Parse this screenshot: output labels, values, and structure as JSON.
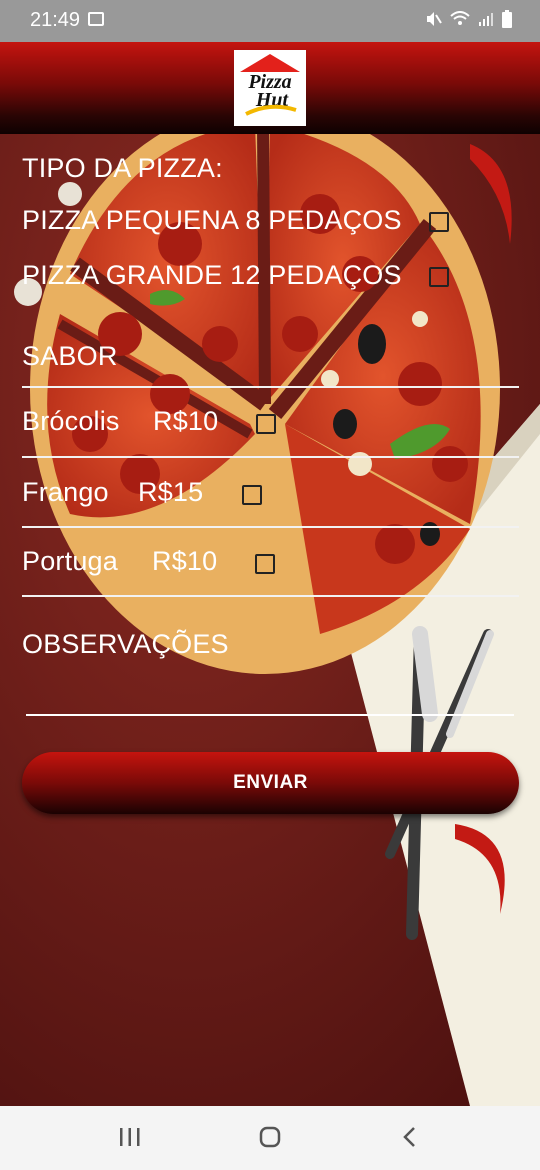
{
  "status_bar": {
    "time": "21:49"
  },
  "app_bar": {
    "logo_text_top": "Pizza",
    "logo_text_bottom": "Hut"
  },
  "form": {
    "size_label": "TIPO DA PIZZA:",
    "sizes": [
      {
        "label": "PIZZA PEQUENA 8 PEDAÇOS",
        "checked": false
      },
      {
        "label": "PIZZA GRANDE 12 PEDAÇOS",
        "checked": false
      }
    ],
    "flavor_label": "SABOR",
    "flavors": [
      {
        "name": "Brócolis",
        "price": "R$10",
        "checked": false
      },
      {
        "name": "Frango",
        "price": "R$15",
        "checked": false
      },
      {
        "name": "Portuga",
        "price": "R$10",
        "checked": false
      }
    ],
    "notes_label": "OBSERVAÇÕES",
    "notes_value": "",
    "submit_label": "ENVIAR"
  },
  "colors": {
    "brand_red": "#c4140f",
    "background": "#6e1e19"
  }
}
